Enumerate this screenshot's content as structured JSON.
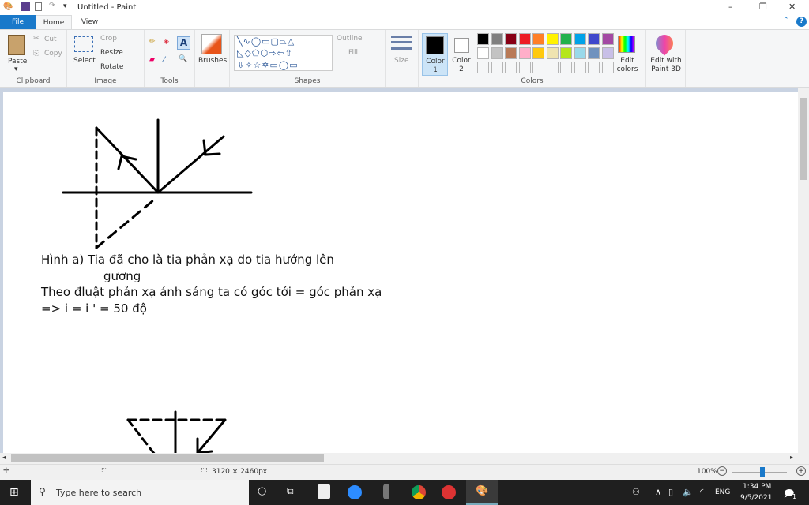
{
  "window": {
    "title": "Untitled - Paint",
    "minimize": "–",
    "maximize": "❐",
    "close": "✕"
  },
  "tabs": [
    {
      "label": "File"
    },
    {
      "label": "Home"
    },
    {
      "label": "View"
    }
  ],
  "ribbon": {
    "clipboard": {
      "label": "Clipboard",
      "paste": "Paste",
      "cut": "Cut",
      "copy": "Copy"
    },
    "image": {
      "label": "Image",
      "select": "Select",
      "crop": "Crop",
      "resize": "Resize",
      "rotate": "Rotate"
    },
    "tools": {
      "label": "Tools"
    },
    "brushes": {
      "label": "Brushes"
    },
    "shapes": {
      "label": "Shapes",
      "outline": "Outline",
      "fill": "Fill"
    },
    "size": {
      "label": "Size"
    },
    "colors": {
      "label": "Colors",
      "color1": "Color 1",
      "color2": "Color 2",
      "edit": "Edit colors",
      "palette_row1": [
        "#000000",
        "#7f7f7f",
        "#880015",
        "#ed1c24",
        "#ff7f27",
        "#fff200",
        "#22b14c",
        "#00a2e8",
        "#3f48cc",
        "#a349a4"
      ],
      "palette_row2": [
        "#ffffff",
        "#c3c3c3",
        "#b97a57",
        "#ffaec9",
        "#ffc90e",
        "#efe4b0",
        "#b5e61d",
        "#99d9ea",
        "#7092be",
        "#c8bfe7"
      ]
    },
    "paint3d": "Edit with Paint 3D"
  },
  "canvas": {
    "lines": [
      "Hình a)   Tia đã cho là tia phản xạ do tia hướng lên",
      "gương",
      "Theo đluật phản xạ ánh sáng ta có góc tới = góc phản xạ",
      "=> i = i ' = 50 độ"
    ]
  },
  "status": {
    "dimensions": "3120 × 2460px",
    "zoom": "100%"
  },
  "taskbar": {
    "search_placeholder": "Type here to search",
    "time": "1:34 PM",
    "date": "9/5/2021",
    "lang": "ENG",
    "notifications": "1"
  }
}
